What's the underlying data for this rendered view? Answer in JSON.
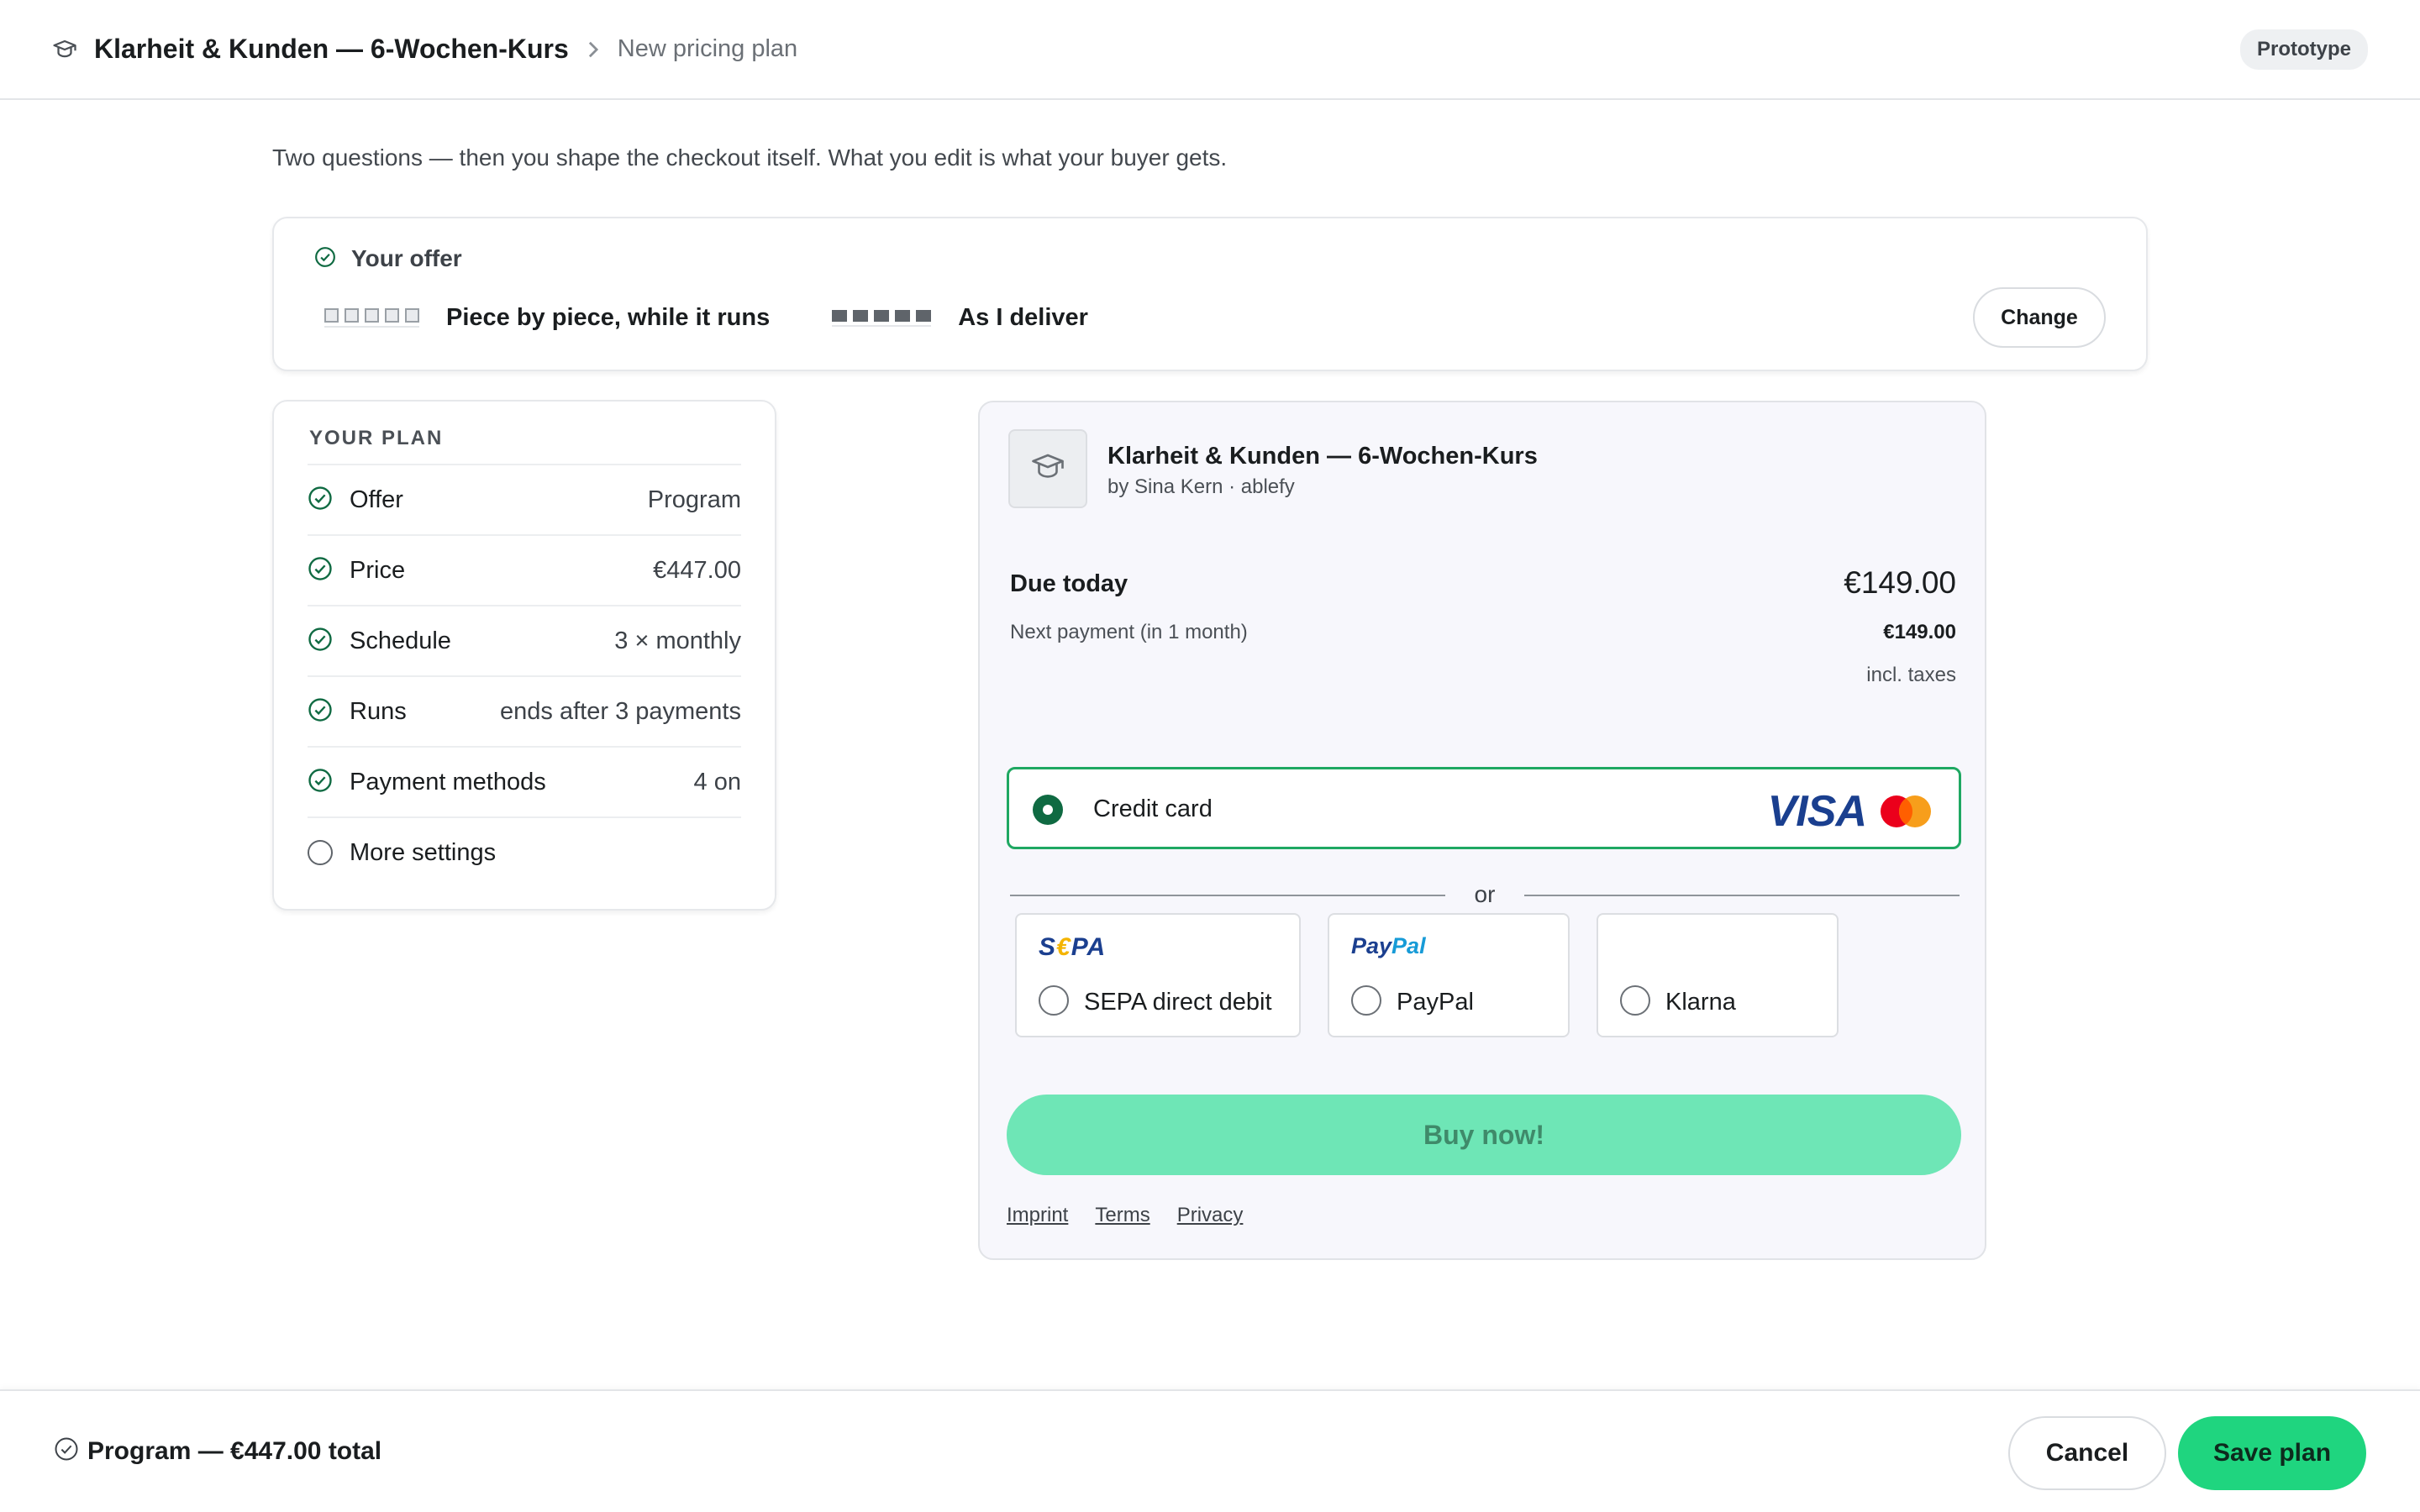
{
  "header": {
    "title": "Klarheit & Kunden — 6-Wochen-Kurs",
    "breadcrumb": "New pricing plan",
    "badge": "Prototype"
  },
  "intro": "Two questions — then you shape the checkout itself. What you edit is what your buyer gets.",
  "offer": {
    "label": "Your offer",
    "option_1": "Piece by piece, while it runs",
    "option_2": "As I deliver",
    "change_label": "Change"
  },
  "plan": {
    "caption": "YOUR PLAN",
    "rows": [
      {
        "key": "Offer",
        "value": "Program",
        "done": true
      },
      {
        "key": "Price",
        "value": "€447.00",
        "done": true
      },
      {
        "key": "Schedule",
        "value": "3 × monthly",
        "done": true
      },
      {
        "key": "Runs",
        "value": "ends after 3 payments",
        "done": true
      },
      {
        "key": "Payment methods",
        "value": "4 on",
        "done": true
      },
      {
        "key": "More settings",
        "value": "",
        "done": false
      }
    ]
  },
  "checkout": {
    "product_name": "Klarheit & Kunden — 6-Wochen-Kurs",
    "product_by": "by Sina Kern · ablefy",
    "due_label": "Due today",
    "due_amount": "€149.00",
    "next_label": "Next payment (in 1 month)",
    "next_amount": "€149.00",
    "tax_note": "incl. taxes",
    "credit_card_label": "Credit card",
    "visa_text": "VISA",
    "or_text": "or",
    "methods": [
      {
        "label": "SEPA direct debit",
        "logo": "sepa-logo"
      },
      {
        "label": "PayPal",
        "logo": "paypal-logo"
      },
      {
        "label": "Klarna",
        "logo": ""
      }
    ],
    "sepa_logo_parts": [
      "S",
      "€",
      "PA"
    ],
    "paypal_logo_parts": [
      "Pay",
      "Pal"
    ],
    "buy_label": "Buy now!",
    "legal": [
      "Imprint",
      "Terms",
      "Privacy"
    ]
  },
  "footer": {
    "summary": "Program — €447.00 total",
    "cancel_label": "Cancel",
    "save_label": "Save plan"
  },
  "colors": {
    "accent": "#1fd57f",
    "selected_border": "#1fa862",
    "check": "#0f6a42",
    "buy_disabled": "#6ee6b6"
  },
  "icons": [
    "graduation-cap-icon",
    "chevron-right-icon",
    "check-circle-icon",
    "radio-selected-icon",
    "radio-empty-icon",
    "mastercard-icon"
  ]
}
